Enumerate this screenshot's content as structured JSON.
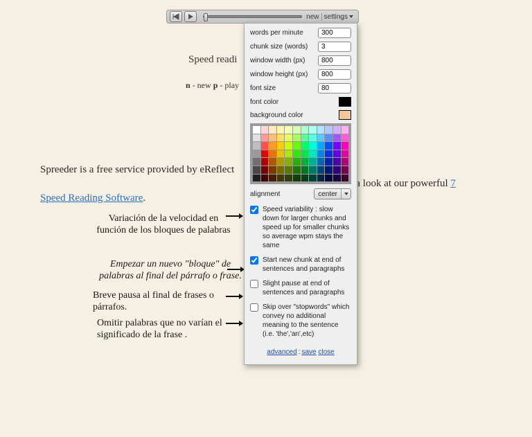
{
  "toolbar": {
    "new_label": "new",
    "settings_label": "settings"
  },
  "main": {
    "heading": "Speed readi",
    "help_n_key": "n",
    "help_n_text": " - new   ",
    "help_p_key": "p",
    "help_p_text": " - play",
    "desc_pre": "Spreeder is a free service provided by eReflect",
    "desc_mid": "te, please have a look at our powerful ",
    "link_text": "7 Speed Reading Software",
    "desc_post": "."
  },
  "settings": {
    "wpm_label": "words per minute",
    "wpm_value": "300",
    "chunk_label": "chunk size (words)",
    "chunk_value": "3",
    "ww_label": "window width (px)",
    "ww_value": "800",
    "wh_label": "window height (px)",
    "wh_value": "800",
    "fs_label": "font size",
    "fs_value": "80",
    "fc_label": "font color",
    "fc_value": "#000000",
    "bg_label": "background color",
    "bg_value": "#f0c998",
    "align_label": "alignment",
    "align_value": "center",
    "opt1_checked": true,
    "opt1_text": "Speed variability : slow down for larger chunks and speed up for smaller chunks so average wpm stays the same",
    "opt2_checked": true,
    "opt2_text": "Start new chunk at end of sentences and paragraphs",
    "opt3_checked": false,
    "opt3_text": "Slight pause at end of sentences and paragraphs",
    "opt4_checked": false,
    "opt4_text": "Skip over \"stopwords\" which convey no additional meaning to the sentence (i.e. 'the','an',etc)",
    "advanced_label": "advanced",
    "save_label": "save",
    "close_label": "close"
  },
  "annotations": {
    "a1": "Variación de la velocidad en función de los bloques de palabras",
    "a2": "Empezar un nuevo \"bloque\" de palabras al final del párrafo o frase.",
    "a3": "Breve pausa al final de frases o párrafos.",
    "a4": "Omitir palabras que no varían el significado de la frase ."
  },
  "palette_colors": [
    "#ffffff",
    "#ffd6d6",
    "#ffe9c7",
    "#fff3b0",
    "#f4ffb0",
    "#d4ffb0",
    "#b0ffd0",
    "#b0fff2",
    "#b0e5ff",
    "#b0c7ff",
    "#d0b0ff",
    "#ffb0f0",
    "#e0e0e0",
    "#ff9a9a",
    "#ffc17a",
    "#ffe05a",
    "#e7ff5a",
    "#a8ff5a",
    "#5aff9a",
    "#5affe6",
    "#5acbff",
    "#5a8fff",
    "#a05aff",
    "#ff5ad8",
    "#bdbdbd",
    "#ff4f4f",
    "#ff9b2b",
    "#ffcc00",
    "#ccff00",
    "#66ff00",
    "#00ff66",
    "#00ffd4",
    "#00aaff",
    "#0050ff",
    "#7a00ff",
    "#ff00b8",
    "#9a9a9a",
    "#e80000",
    "#e87200",
    "#e8c400",
    "#aee800",
    "#34e800",
    "#00e846",
    "#00e8c0",
    "#0086e8",
    "#0030e8",
    "#6000e8",
    "#e8009c",
    "#707070",
    "#b00000",
    "#b05800",
    "#b09800",
    "#86b000",
    "#28b000",
    "#00b036",
    "#00b094",
    "#0068b0",
    "#0024b0",
    "#4a00b0",
    "#b00078",
    "#484848",
    "#780000",
    "#783c00",
    "#786800",
    "#5c7800",
    "#1c7800",
    "#007824",
    "#007864",
    "#004678",
    "#001878",
    "#320078",
    "#780052",
    "#202020",
    "#400000",
    "#402000",
    "#403800",
    "#304000",
    "#0e4000",
    "#004014",
    "#004036",
    "#002640",
    "#000c40",
    "#1a0040",
    "#40002c"
  ]
}
